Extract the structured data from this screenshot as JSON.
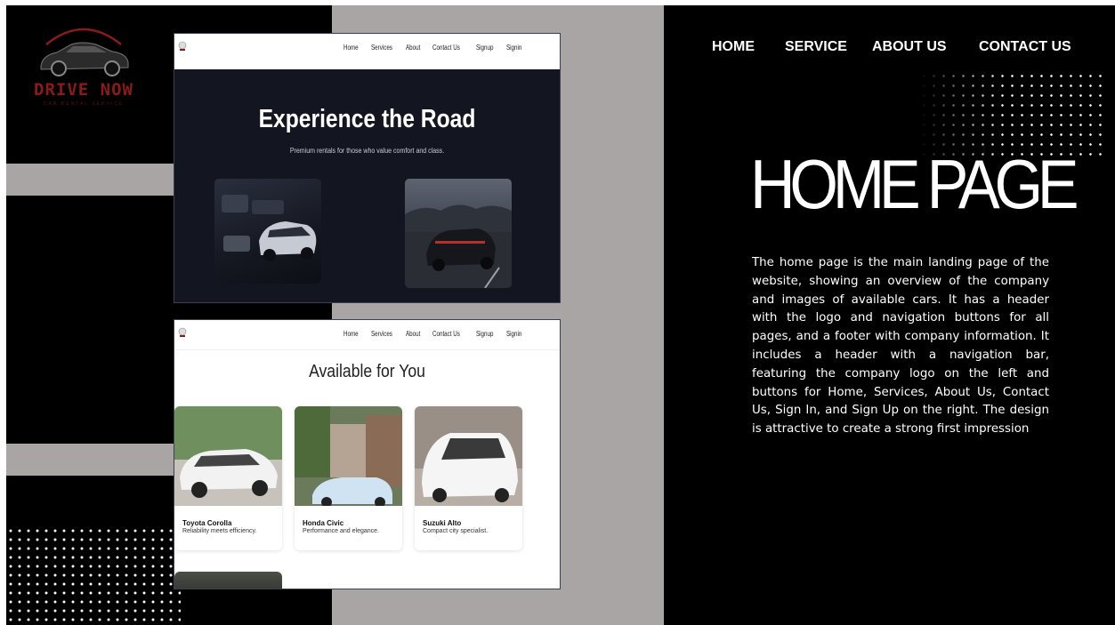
{
  "brand": {
    "logo_text": "DRIVE NOW",
    "logo_tagline": "CAR RENTAL SERVICE",
    "accent": "#8b1a1a"
  },
  "colors": {
    "background": "#000000",
    "panel_gray": "#aaa5a5",
    "text": "#ffffff"
  },
  "top_nav": [
    "HOME",
    "SERVICE",
    "ABOUT US",
    "CONTACT US"
  ],
  "page_title": "HOME PAGE",
  "description": "The home page is the main landing page of the website, showing an overview of the company and images of available cars. It has a header with the logo and navigation buttons for all pages, and a footer with company information. It includes a header with a navigation bar, featuring the company logo on the left and buttons for Home, Services, About Us, Contact Us, Sign In, and Sign Up on the right. The design is attractive to create a strong first impression",
  "mockup": {
    "nav": [
      "Home",
      "Services",
      "About",
      "Contact Us",
      "Signup",
      "Signin"
    ],
    "hero_title": "Experience the Road",
    "hero_subtitle": "Premium rentals for those who value comfort and class.",
    "available_title": "Available for You",
    "cars": [
      {
        "name": "Toyota Corolla",
        "desc": "Reliability meets efficiency."
      },
      {
        "name": "Honda Civic",
        "desc": "Performance and elegance."
      },
      {
        "name": "Suzuki Alto",
        "desc": "Compact city specialist."
      }
    ]
  }
}
